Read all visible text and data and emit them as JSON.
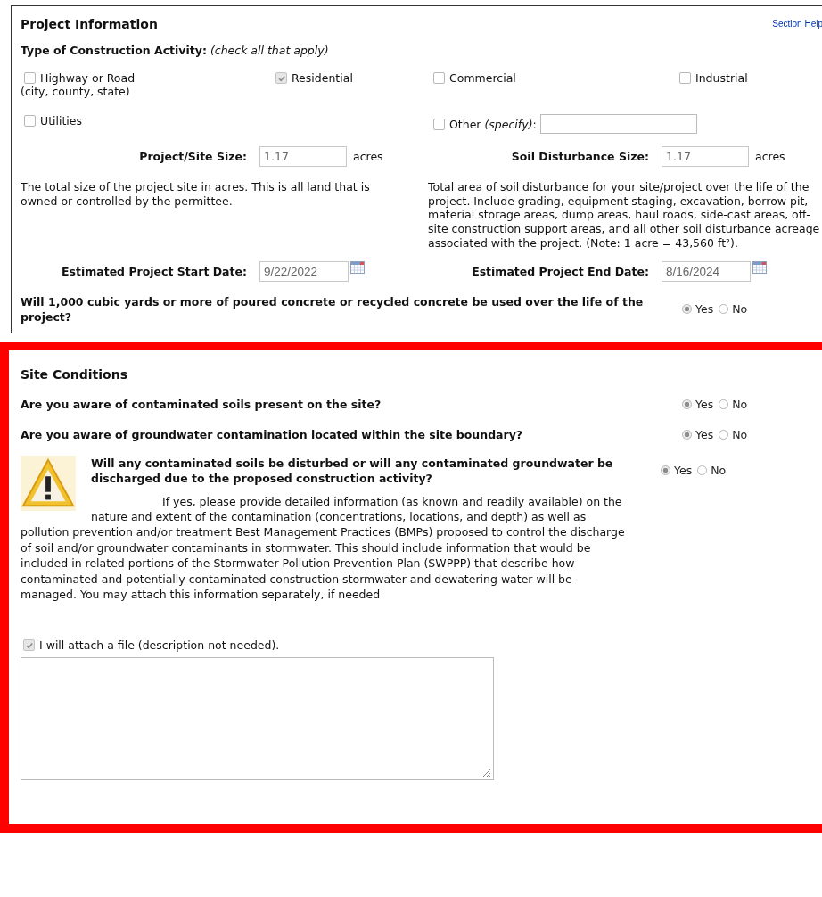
{
  "project_information": {
    "title": "Project Information",
    "section_help": "Section Help",
    "activity_type": "**Type of Construction Activity:** *(check all that apply)*",
    "activities": [
      {
        "kind": "plain",
        "label": "Highway or Road",
        "note": "(city, county, state)",
        "checked": false
      },
      {
        "kind": "plain",
        "label": "Residential",
        "checked": true
      },
      {
        "kind": "plain",
        "label": "Commercial",
        "checked": false
      },
      {
        "kind": "plain",
        "label": "Industrial",
        "checked": false
      },
      {
        "kind": "plain",
        "label": "Utilities",
        "checked": false
      },
      {
        "kind": "with_field",
        "label": "Other *(specify)*:",
        "checked": false
      }
    ],
    "sizes": [
      {
        "label": "Project/Site Size:",
        "value": "1.17",
        "unit": "acres",
        "description": "The total size of the project site in acres. This is all land that is owned or controlled by the permittee."
      },
      {
        "label": "Soil Disturbance Size:",
        "value": "1.17",
        "unit": "acres",
        "description": "Total area of soil disturbance for your site/project over the life of the project. Include grading, equipment staging, excavation, borrow pit, material storage areas, dump areas, haul roads, side-cast areas, off-site construction support areas, and all other soil disturbance acreage associated with the project. (Note: 1 acre = 43,560 ft²)."
      }
    ],
    "dates": [
      {
        "label": "Estimated Project Start Date:",
        "value": "9/22/2022"
      },
      {
        "label": "Estimated Project End Date:",
        "value": "8/16/2024"
      }
    ],
    "questions": [
      {
        "text": "Will 1,000 cubic yards or more of poured concrete or recycled concrete be used over the life of the project?",
        "options": [
          {
            "label": "Yes",
            "selected": true
          },
          {
            "label": "No",
            "selected": false
          }
        ]
      }
    ]
  },
  "site_conditions": {
    "title": "Site Conditions",
    "questions": [
      {
        "kind": "plain",
        "text": "Are you aware of contaminated soils present on the site?",
        "options": [
          {
            "label": "Yes",
            "selected": true
          },
          {
            "label": "No",
            "selected": false
          }
        ]
      },
      {
        "kind": "plain",
        "text": "Are you aware of groundwater contamination located within the site boundary?",
        "options": [
          {
            "label": "Yes",
            "selected": true
          },
          {
            "label": "No",
            "selected": false
          }
        ]
      },
      {
        "kind": "warning",
        "text": "Will any contaminated soils be disturbed or will any contaminated groundwater be discharged due to the proposed construction activity?",
        "options": [
          {
            "label": "Yes",
            "selected": true
          },
          {
            "label": "No",
            "selected": false
          }
        ],
        "details": "If yes, please provide detailed information (as known and readily available) on the nature and extent of the contamination (concentrations, locations, and depth) as well as pollution prevention and/or treatment Best Management Practices (BMPs) proposed to control the discharge of soil and/or groundwater contaminants in stormwater. This should include information that would be included in related portions of the Stormwater Pollution Prevention Plan (SWPPP) that describe how contaminated and potentially contaminated construction stormwater and dewatering water will be managed. You may attach this information separately, if needed"
      }
    ],
    "attach": {
      "label": "I will attach a file (description not needed).",
      "checked": true
    }
  }
}
